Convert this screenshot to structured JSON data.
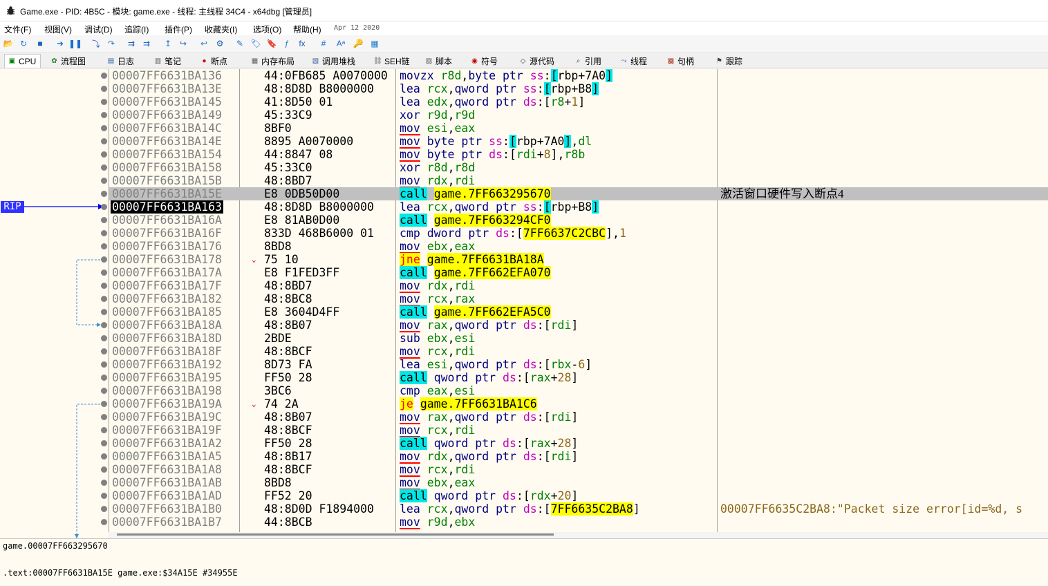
{
  "window": {
    "title": "Game.exe - PID: 4B5C - 模块: game.exe - 线程: 主线程 34C4 - x64dbg [管理员]",
    "icon": "bug-icon"
  },
  "menu": {
    "items": [
      "文件(F)",
      "视图(V)",
      "调试(D)",
      "追踪(I)",
      "插件(P)",
      "收藏夹(I)",
      "选项(O)",
      "帮助(H)"
    ],
    "date": "Apr 12 2020"
  },
  "toolbar": {
    "icons": [
      "open-icon",
      "restart-icon",
      "stop-icon",
      "run-icon",
      "pause-icon",
      "step-into-icon",
      "step-over-icon",
      "trace-into-icon",
      "trace-over-icon",
      "execute-till-return-icon",
      "run-to-user-code-icon",
      "step-back-icon",
      "scylla-icon",
      "comment-icon",
      "label-icon",
      "bookmark-icon",
      "function-icon",
      "fx-icon",
      "hash-icon",
      "font-icon",
      "strings-icon",
      "calculator-icon",
      "globe-icon"
    ],
    "glyphs": [
      "📂",
      "↻",
      "■",
      "➜",
      "❚❚",
      "⤵",
      "↷",
      "⇉",
      "⇉",
      "↥",
      "↪",
      "↩",
      "⚙",
      "✎",
      "🏷",
      "🔖",
      "ƒ",
      "fx",
      "#",
      "Aᵃ",
      "🔑",
      "▦",
      "🌐"
    ]
  },
  "tabs": [
    {
      "label": "CPU",
      "icon": "cpu-icon",
      "glyph": "▣",
      "active": true
    },
    {
      "label": "流程图",
      "icon": "graph-icon",
      "glyph": "✿"
    },
    {
      "label": "日志",
      "icon": "log-icon",
      "glyph": "▤"
    },
    {
      "label": "笔记",
      "icon": "notes-icon",
      "glyph": "▥"
    },
    {
      "label": "断点",
      "icon": "breakpoint-icon",
      "glyph": "●"
    },
    {
      "label": "内存布局",
      "icon": "memory-map-icon",
      "glyph": "▦"
    },
    {
      "label": "调用堆栈",
      "icon": "call-stack-icon",
      "glyph": "▧"
    },
    {
      "label": "SEH链",
      "icon": "seh-icon",
      "glyph": "⛓"
    },
    {
      "label": "脚本",
      "icon": "script-icon",
      "glyph": "▨"
    },
    {
      "label": "符号",
      "icon": "symbols-icon",
      "glyph": "◉"
    },
    {
      "label": "源代码",
      "icon": "source-icon",
      "glyph": "◇"
    },
    {
      "label": "引用",
      "icon": "references-icon",
      "glyph": "⌕"
    },
    {
      "label": "线程",
      "icon": "threads-icon",
      "glyph": "⤳"
    },
    {
      "label": "句柄",
      "icon": "handles-icon",
      "glyph": "▩"
    },
    {
      "label": "跟踪",
      "icon": "trace-icon",
      "glyph": "⚑"
    }
  ],
  "rip_label": "RIP",
  "disasm": [
    {
      "addr": "00007FF6631BA136",
      "bytes": "44:0FB685 A0070000",
      "ins": [
        [
          "mn",
          "movzx"
        ],
        [
          "t",
          " "
        ],
        [
          "reg",
          "r8d"
        ],
        [
          "t",
          ","
        ],
        [
          "sz",
          "byte ptr"
        ],
        [
          "t",
          " "
        ],
        [
          "seg",
          "ss"
        ],
        [
          "t",
          ":"
        ],
        [
          "brk",
          "["
        ],
        [
          "t",
          "rbp+7A0"
        ],
        [
          "brk",
          "]"
        ]
      ]
    },
    {
      "addr": "00007FF6631BA13E",
      "bytes": "48:8D8D B8000000",
      "ins": [
        [
          "mn",
          "lea"
        ],
        [
          "t",
          " "
        ],
        [
          "reg",
          "rcx"
        ],
        [
          "t",
          ","
        ],
        [
          "sz",
          "qword ptr"
        ],
        [
          "t",
          " "
        ],
        [
          "seg",
          "ss"
        ],
        [
          "t",
          ":"
        ],
        [
          "brk",
          "["
        ],
        [
          "t",
          "rbp+B8"
        ],
        [
          "brk",
          "]"
        ]
      ]
    },
    {
      "addr": "00007FF6631BA145",
      "bytes": "41:8D50 01",
      "ins": [
        [
          "mn",
          "lea"
        ],
        [
          "t",
          " "
        ],
        [
          "reg",
          "edx"
        ],
        [
          "t",
          ","
        ],
        [
          "sz",
          "qword ptr"
        ],
        [
          "t",
          " "
        ],
        [
          "seg",
          "ds"
        ],
        [
          "t",
          ":["
        ],
        [
          "reg",
          "r8"
        ],
        [
          "t",
          "+"
        ],
        [
          "num",
          "1"
        ],
        [
          "t",
          "]"
        ]
      ]
    },
    {
      "addr": "00007FF6631BA149",
      "bytes": "45:33C9",
      "ins": [
        [
          "mn",
          "xor"
        ],
        [
          "t",
          " "
        ],
        [
          "reg",
          "r9d"
        ],
        [
          "t",
          ","
        ],
        [
          "reg",
          "r9d"
        ]
      ]
    },
    {
      "addr": "00007FF6631BA14C",
      "bytes": "8BF0",
      "ins": [
        [
          "mov",
          "mov"
        ],
        [
          "t",
          " "
        ],
        [
          "reg",
          "esi"
        ],
        [
          "t",
          ","
        ],
        [
          "reg",
          "eax"
        ]
      ]
    },
    {
      "addr": "00007FF6631BA14E",
      "bytes": "8895 A0070000",
      "ins": [
        [
          "mov",
          "mov"
        ],
        [
          "t",
          " "
        ],
        [
          "sz",
          "byte ptr"
        ],
        [
          "t",
          " "
        ],
        [
          "seg",
          "ss"
        ],
        [
          "t",
          ":"
        ],
        [
          "brk",
          "["
        ],
        [
          "t",
          "rbp+7A0"
        ],
        [
          "brk",
          "]"
        ],
        [
          "t",
          ","
        ],
        [
          "reg",
          "dl"
        ]
      ]
    },
    {
      "addr": "00007FF6631BA154",
      "bytes": "44:8847 08",
      "ins": [
        [
          "mov",
          "mov"
        ],
        [
          "t",
          " "
        ],
        [
          "sz",
          "byte ptr"
        ],
        [
          "t",
          " "
        ],
        [
          "seg",
          "ds"
        ],
        [
          "t",
          ":["
        ],
        [
          "reg",
          "rdi"
        ],
        [
          "t",
          "+"
        ],
        [
          "num",
          "8"
        ],
        [
          "t",
          "],"
        ],
        [
          "reg",
          "r8b"
        ]
      ]
    },
    {
      "addr": "00007FF6631BA158",
      "bytes": "45:33C0",
      "ins": [
        [
          "mn",
          "xor"
        ],
        [
          "t",
          " "
        ],
        [
          "reg",
          "r8d"
        ],
        [
          "t",
          ","
        ],
        [
          "reg",
          "r8d"
        ]
      ]
    },
    {
      "addr": "00007FF6631BA15B",
      "bytes": "48:8BD7",
      "ins": [
        [
          "mov",
          "mov"
        ],
        [
          "t",
          " "
        ],
        [
          "reg",
          "rdx"
        ],
        [
          "t",
          ","
        ],
        [
          "reg",
          "rdi"
        ]
      ]
    },
    {
      "addr": "00007FF6631BA15E",
      "bytes": "E8 0DB50D00",
      "ins": [
        [
          "call",
          "call"
        ],
        [
          "t",
          " "
        ],
        [
          "ref",
          "game.7FF663295670"
        ]
      ],
      "comment": "激活窗口硬件写入断点4",
      "current": true
    },
    {
      "addr": "00007FF6631BA163",
      "bytes": "48:8D8D B8000000",
      "ins": [
        [
          "mn",
          "lea"
        ],
        [
          "t",
          " "
        ],
        [
          "reg",
          "rcx"
        ],
        [
          "t",
          ","
        ],
        [
          "sz",
          "qword ptr"
        ],
        [
          "t",
          " "
        ],
        [
          "seg",
          "ss"
        ],
        [
          "t",
          ":"
        ],
        [
          "brk",
          "["
        ],
        [
          "t",
          "rbp+B8"
        ],
        [
          "brk",
          "]"
        ]
      ],
      "rip": true
    },
    {
      "addr": "00007FF6631BA16A",
      "bytes": "E8 81AB0D00",
      "ins": [
        [
          "call",
          "call"
        ],
        [
          "t",
          " "
        ],
        [
          "ref",
          "game.7FF663294CF0"
        ]
      ]
    },
    {
      "addr": "00007FF6631BA16F",
      "bytes": "833D 468B6000 01",
      "ins": [
        [
          "mn",
          "cmp"
        ],
        [
          "t",
          " "
        ],
        [
          "sz",
          "dword ptr"
        ],
        [
          "t",
          " "
        ],
        [
          "seg",
          "ds"
        ],
        [
          "t",
          ":["
        ],
        [
          "ref",
          "7FF6637C2CBC"
        ],
        [
          "t",
          "],"
        ],
        [
          "num",
          "1"
        ]
      ]
    },
    {
      "addr": "00007FF6631BA176",
      "bytes": "8BD8",
      "ins": [
        [
          "mov",
          "mov"
        ],
        [
          "t",
          " "
        ],
        [
          "reg",
          "ebx"
        ],
        [
          "t",
          ","
        ],
        [
          "reg",
          "eax"
        ]
      ]
    },
    {
      "addr": "00007FF6631BA178",
      "bytes": "75 10",
      "ins": [
        [
          "jcc",
          "jne"
        ],
        [
          "t",
          " "
        ],
        [
          "ref",
          "game.7FF6631BA18A"
        ]
      ],
      "jump": true
    },
    {
      "addr": "00007FF6631BA17A",
      "bytes": "E8 F1FED3FF",
      "ins": [
        [
          "call",
          "call"
        ],
        [
          "t",
          " "
        ],
        [
          "ref",
          "game.7FF662EFA070"
        ]
      ]
    },
    {
      "addr": "00007FF6631BA17F",
      "bytes": "48:8BD7",
      "ins": [
        [
          "mov",
          "mov"
        ],
        [
          "t",
          " "
        ],
        [
          "reg",
          "rdx"
        ],
        [
          "t",
          ","
        ],
        [
          "reg",
          "rdi"
        ]
      ]
    },
    {
      "addr": "00007FF6631BA182",
      "bytes": "48:8BC8",
      "ins": [
        [
          "mov",
          "mov"
        ],
        [
          "t",
          " "
        ],
        [
          "reg",
          "rcx"
        ],
        [
          "t",
          ","
        ],
        [
          "reg",
          "rax"
        ]
      ]
    },
    {
      "addr": "00007FF6631BA185",
      "bytes": "E8 3604D4FF",
      "ins": [
        [
          "call",
          "call"
        ],
        [
          "t",
          " "
        ],
        [
          "ref",
          "game.7FF662EFA5C0"
        ]
      ]
    },
    {
      "addr": "00007FF6631BA18A",
      "bytes": "48:8B07",
      "ins": [
        [
          "mov",
          "mov"
        ],
        [
          "t",
          " "
        ],
        [
          "reg",
          "rax"
        ],
        [
          "t",
          ","
        ],
        [
          "sz",
          "qword ptr"
        ],
        [
          "t",
          " "
        ],
        [
          "seg",
          "ds"
        ],
        [
          "t",
          ":["
        ],
        [
          "reg",
          "rdi"
        ],
        [
          "t",
          "]"
        ]
      ]
    },
    {
      "addr": "00007FF6631BA18D",
      "bytes": "2BDE",
      "ins": [
        [
          "mn",
          "sub"
        ],
        [
          "t",
          " "
        ],
        [
          "reg",
          "ebx"
        ],
        [
          "t",
          ","
        ],
        [
          "reg",
          "esi"
        ]
      ]
    },
    {
      "addr": "00007FF6631BA18F",
      "bytes": "48:8BCF",
      "ins": [
        [
          "mov",
          "mov"
        ],
        [
          "t",
          " "
        ],
        [
          "reg",
          "rcx"
        ],
        [
          "t",
          ","
        ],
        [
          "reg",
          "rdi"
        ]
      ]
    },
    {
      "addr": "00007FF6631BA192",
      "bytes": "8D73 FA",
      "ins": [
        [
          "mn",
          "lea"
        ],
        [
          "t",
          " "
        ],
        [
          "reg",
          "esi"
        ],
        [
          "t",
          ","
        ],
        [
          "sz",
          "qword ptr"
        ],
        [
          "t",
          " "
        ],
        [
          "seg",
          "ds"
        ],
        [
          "t",
          ":["
        ],
        [
          "reg",
          "rbx"
        ],
        [
          "t",
          "-"
        ],
        [
          "num",
          "6"
        ],
        [
          "t",
          "]"
        ]
      ]
    },
    {
      "addr": "00007FF6631BA195",
      "bytes": "FF50 28",
      "ins": [
        [
          "call",
          "call"
        ],
        [
          "t",
          " "
        ],
        [
          "sz",
          "qword ptr"
        ],
        [
          "t",
          " "
        ],
        [
          "seg",
          "ds"
        ],
        [
          "t",
          ":["
        ],
        [
          "reg",
          "rax"
        ],
        [
          "t",
          "+"
        ],
        [
          "num",
          "28"
        ],
        [
          "t",
          "]"
        ]
      ]
    },
    {
      "addr": "00007FF6631BA198",
      "bytes": "3BC6",
      "ins": [
        [
          "mn",
          "cmp"
        ],
        [
          "t",
          " "
        ],
        [
          "reg",
          "eax"
        ],
        [
          "t",
          ","
        ],
        [
          "reg",
          "esi"
        ]
      ]
    },
    {
      "addr": "00007FF6631BA19A",
      "bytes": "74 2A",
      "ins": [
        [
          "jcc",
          "je"
        ],
        [
          "t",
          " "
        ],
        [
          "ref",
          "game.7FF6631BA1C6"
        ]
      ],
      "jump": true
    },
    {
      "addr": "00007FF6631BA19C",
      "bytes": "48:8B07",
      "ins": [
        [
          "mov",
          "mov"
        ],
        [
          "t",
          " "
        ],
        [
          "reg",
          "rax"
        ],
        [
          "t",
          ","
        ],
        [
          "sz",
          "qword ptr"
        ],
        [
          "t",
          " "
        ],
        [
          "seg",
          "ds"
        ],
        [
          "t",
          ":["
        ],
        [
          "reg",
          "rdi"
        ],
        [
          "t",
          "]"
        ]
      ]
    },
    {
      "addr": "00007FF6631BA19F",
      "bytes": "48:8BCF",
      "ins": [
        [
          "mov",
          "mov"
        ],
        [
          "t",
          " "
        ],
        [
          "reg",
          "rcx"
        ],
        [
          "t",
          ","
        ],
        [
          "reg",
          "rdi"
        ]
      ]
    },
    {
      "addr": "00007FF6631BA1A2",
      "bytes": "FF50 28",
      "ins": [
        [
          "call",
          "call"
        ],
        [
          "t",
          " "
        ],
        [
          "sz",
          "qword ptr"
        ],
        [
          "t",
          " "
        ],
        [
          "seg",
          "ds"
        ],
        [
          "t",
          ":["
        ],
        [
          "reg",
          "rax"
        ],
        [
          "t",
          "+"
        ],
        [
          "num",
          "28"
        ],
        [
          "t",
          "]"
        ]
      ]
    },
    {
      "addr": "00007FF6631BA1A5",
      "bytes": "48:8B17",
      "ins": [
        [
          "mov",
          "mov"
        ],
        [
          "t",
          " "
        ],
        [
          "reg",
          "rdx"
        ],
        [
          "t",
          ","
        ],
        [
          "sz",
          "qword ptr"
        ],
        [
          "t",
          " "
        ],
        [
          "seg",
          "ds"
        ],
        [
          "t",
          ":["
        ],
        [
          "reg",
          "rdi"
        ],
        [
          "t",
          "]"
        ]
      ]
    },
    {
      "addr": "00007FF6631BA1A8",
      "bytes": "48:8BCF",
      "ins": [
        [
          "mov",
          "mov"
        ],
        [
          "t",
          " "
        ],
        [
          "reg",
          "rcx"
        ],
        [
          "t",
          ","
        ],
        [
          "reg",
          "rdi"
        ]
      ]
    },
    {
      "addr": "00007FF6631BA1AB",
      "bytes": "8BD8",
      "ins": [
        [
          "mov",
          "mov"
        ],
        [
          "t",
          " "
        ],
        [
          "reg",
          "ebx"
        ],
        [
          "t",
          ","
        ],
        [
          "reg",
          "eax"
        ]
      ]
    },
    {
      "addr": "00007FF6631BA1AD",
      "bytes": "FF52 20",
      "ins": [
        [
          "call",
          "call"
        ],
        [
          "t",
          " "
        ],
        [
          "sz",
          "qword ptr"
        ],
        [
          "t",
          " "
        ],
        [
          "seg",
          "ds"
        ],
        [
          "t",
          ":["
        ],
        [
          "reg",
          "rdx"
        ],
        [
          "t",
          "+"
        ],
        [
          "num",
          "20"
        ],
        [
          "t",
          "]"
        ]
      ]
    },
    {
      "addr": "00007FF6631BA1B0",
      "bytes": "48:8D0D F1894000",
      "ins": [
        [
          "mn",
          "lea"
        ],
        [
          "t",
          " "
        ],
        [
          "reg",
          "rcx"
        ],
        [
          "t",
          ","
        ],
        [
          "sz",
          "qword ptr"
        ],
        [
          "t",
          " "
        ],
        [
          "seg",
          "ds"
        ],
        [
          "t",
          ":["
        ],
        [
          "ref",
          "7FF6635C2BA8"
        ],
        [
          "t",
          "]"
        ]
      ],
      "comment": "00007FF6635C2BA8:\"Packet size error[id=%d, s",
      "comment_str": true
    },
    {
      "addr": "00007FF6631BA1B7",
      "bytes": "44:8BCB",
      "ins": [
        [
          "mov",
          "mov"
        ],
        [
          "t",
          " "
        ],
        [
          "reg",
          "r9d"
        ],
        [
          "t",
          ","
        ],
        [
          "reg",
          "ebx"
        ]
      ]
    }
  ],
  "info": {
    "line1": "game.00007FF663295670",
    "line2": ".text:00007FF6631BA15E game.exe:$34A15E #34955E"
  },
  "colors": {
    "background": "#fffbf0",
    "call_highlight": "#00e8e8",
    "jump_highlight": "#ffff00",
    "current_line": "#c0c0c0",
    "rip_label": "#3030ff"
  }
}
